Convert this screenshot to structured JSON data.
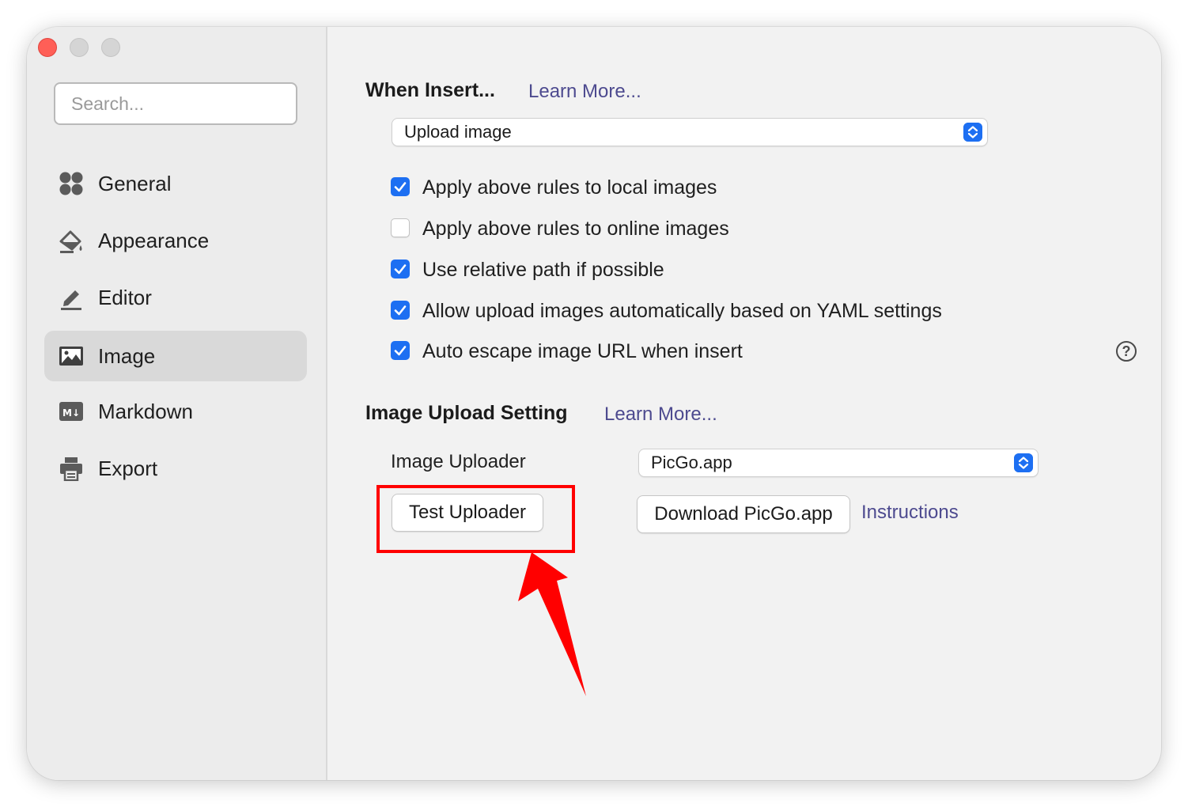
{
  "window": {
    "controls": [
      "close",
      "minimize",
      "maximize"
    ]
  },
  "sidebar": {
    "search_placeholder": "Search...",
    "items": [
      {
        "label": "General",
        "icon": "grid-icon",
        "active": false
      },
      {
        "label": "Appearance",
        "icon": "paint-bucket-icon",
        "active": false
      },
      {
        "label": "Editor",
        "icon": "pencil-icon",
        "active": false
      },
      {
        "label": "Image",
        "icon": "image-icon",
        "active": true
      },
      {
        "label": "Markdown",
        "icon": "markdown-icon",
        "active": false
      },
      {
        "label": "Export",
        "icon": "printer-icon",
        "active": false
      }
    ]
  },
  "main": {
    "when_insert": {
      "title": "When Insert...",
      "learn_more": "Learn More...",
      "selected_option": "Upload image"
    },
    "options": [
      {
        "label": "Apply above rules to local images",
        "checked": true
      },
      {
        "label": "Apply above rules to online images",
        "checked": false
      },
      {
        "label": "Use relative path if possible",
        "checked": true
      },
      {
        "label": "Allow upload images automatically based on YAML settings",
        "checked": true
      },
      {
        "label": "Auto escape image URL when insert",
        "checked": true
      }
    ],
    "help_symbol": "?",
    "upload_setting": {
      "title": "Image Upload Setting",
      "learn_more": "Learn More...",
      "uploader_label": "Image Uploader",
      "uploader_value": "PicGo.app",
      "test_button": "Test Uploader",
      "download_button": "Download PicGo.app",
      "instructions_link": "Instructions"
    }
  },
  "colors": {
    "accent": "#1d6ff2",
    "link": "#4d4a8f",
    "annotation": "#ff0000",
    "close_button": "#ff5f57"
  }
}
